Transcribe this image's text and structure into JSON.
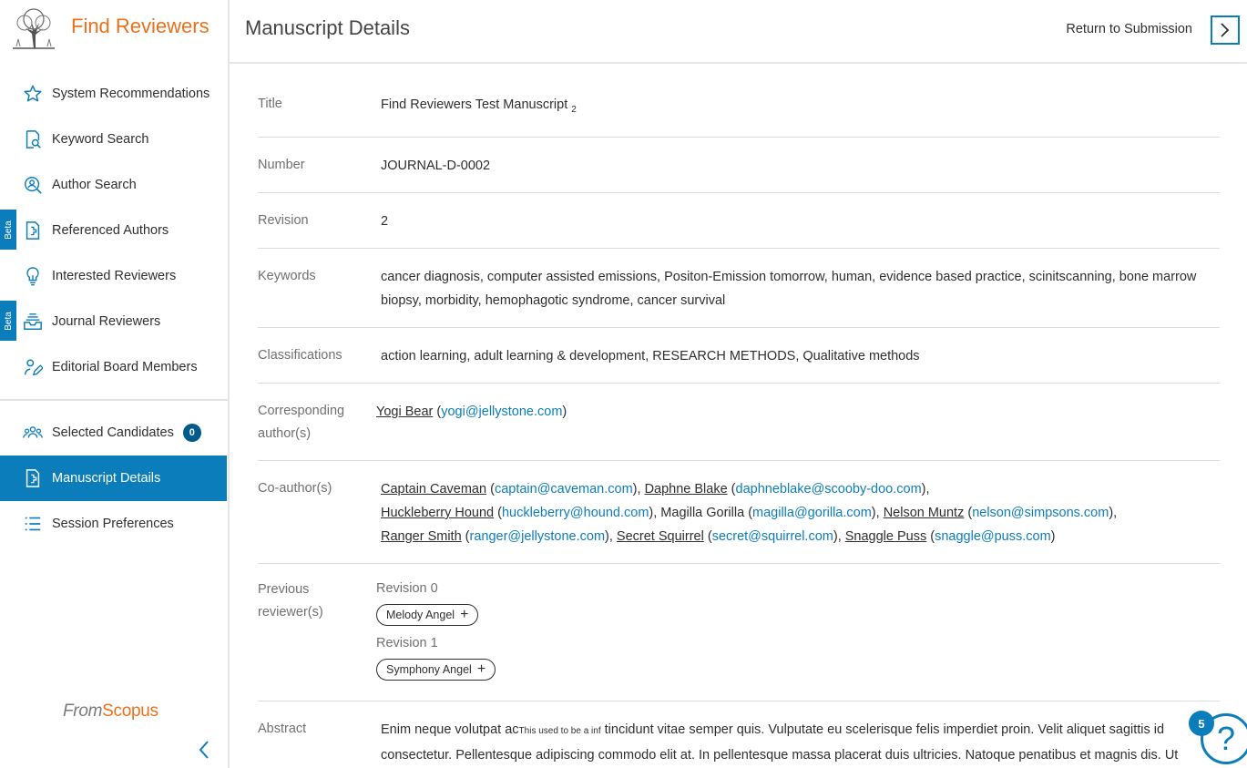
{
  "app": {
    "title": "Find Reviewers"
  },
  "sidebar": {
    "items": [
      {
        "label": "System Recommendations",
        "icon": "star-icon",
        "beta": false
      },
      {
        "label": "Keyword Search",
        "icon": "document-search-icon",
        "beta": false
      },
      {
        "label": "Author Search",
        "icon": "person-search-icon",
        "beta": false
      },
      {
        "label": "Referenced Authors",
        "icon": "document-reference-icon",
        "beta": true
      },
      {
        "label": "Interested Reviewers",
        "icon": "lightbulb-icon",
        "beta": false
      },
      {
        "label": "Journal Reviewers",
        "icon": "inbox-tray-icon",
        "beta": true
      },
      {
        "label": "Editorial Board Members",
        "icon": "pen-person-icon",
        "beta": false
      }
    ],
    "beta_label": "Beta",
    "secondary": [
      {
        "label": "Selected Candidates",
        "icon": "group-icon",
        "count": "0"
      },
      {
        "label": "Manuscript Details",
        "icon": "manuscript-icon",
        "active": true
      },
      {
        "label": "Session Preferences",
        "icon": "list-icon"
      }
    ],
    "footer": {
      "from": "From",
      "scopus": "Scopus"
    }
  },
  "header": {
    "title": "Manuscript Details",
    "return_label": "Return to Submission"
  },
  "details": {
    "title_label": "Title",
    "title_value": "Find Reviewers Test Manuscript",
    "title_sub": "2",
    "number_label": "Number",
    "number_value": "JOURNAL-D-0002",
    "revision_label": "Revision",
    "revision_value": "2",
    "keywords_label": "Keywords",
    "keywords_value": "cancer diagnosis, computer assisted emissions, Positon-Emission tomorrow, human, evidence based practice, scinitscanning, bone marrow biopsy, morbidity, hemophagotic syndrome, cancer survival",
    "classifications_label": "Classifications",
    "classifications_value": "action learning, adult learning & development, RESEARCH METHODS, Qualitative methods",
    "corresponding_label": "Corresponding author(s)",
    "corresponding": {
      "name": "Yogi Bear",
      "email": "yogi@jellystone.com"
    },
    "coauthors_label": "Co-author(s)",
    "coauthors": [
      {
        "name": "Captain Caveman",
        "email": "captain@caveman.com",
        "linked": true
      },
      {
        "name": "Daphne Blake",
        "email": "daphneblake@scooby-doo.com",
        "linked": true
      },
      {
        "name": "Huckleberry Hound",
        "email": "huckleberry@hound.com",
        "linked": true
      },
      {
        "name": "Magilla Gorilla",
        "email": "magilla@gorilla.com",
        "linked": false
      },
      {
        "name": "Nelson Muntz",
        "email": "nelson@simpsons.com",
        "linked": true
      },
      {
        "name": "Ranger Smith",
        "email": "ranger@jellystone.com",
        "linked": true
      },
      {
        "name": "Secret Squirrel",
        "email": "secret@squirrel.com",
        "linked": true
      },
      {
        "name": "Snaggle Puss",
        "email": "snaggle@puss.com",
        "linked": true
      }
    ],
    "previous_label": "Previous reviewer(s)",
    "previous": [
      {
        "revision": "Revision 0",
        "reviewers": [
          "Melody Angel"
        ]
      },
      {
        "revision": "Revision 1",
        "reviewers": [
          "Symphony Angel"
        ]
      }
    ],
    "abstract_label": "Abstract",
    "abstract_start": "Enim neque volutpat ac",
    "abstract_small": "This used to be a inf",
    "abstract_rest": " tincidunt vitae semper quis. Vulputate eu scelerisque felis imperdiet proin. Velit aliquet sagittis id consectetur. Pellentesque adipiscing commodo elit at. In pellentesque massa placerat duis ultricies. Natoque penatibus et magnis dis. Ut ornare lectus sit amet. Non pulvinar neque laoreet suspendisse interdum. Egestas sed tempus urna et pharetra pharetra. Arcu non sodales"
  },
  "help": {
    "count": "5",
    "icon": "question-icon"
  },
  "colors": {
    "accent": "#0c7dbb",
    "brand": "#e9711c"
  }
}
